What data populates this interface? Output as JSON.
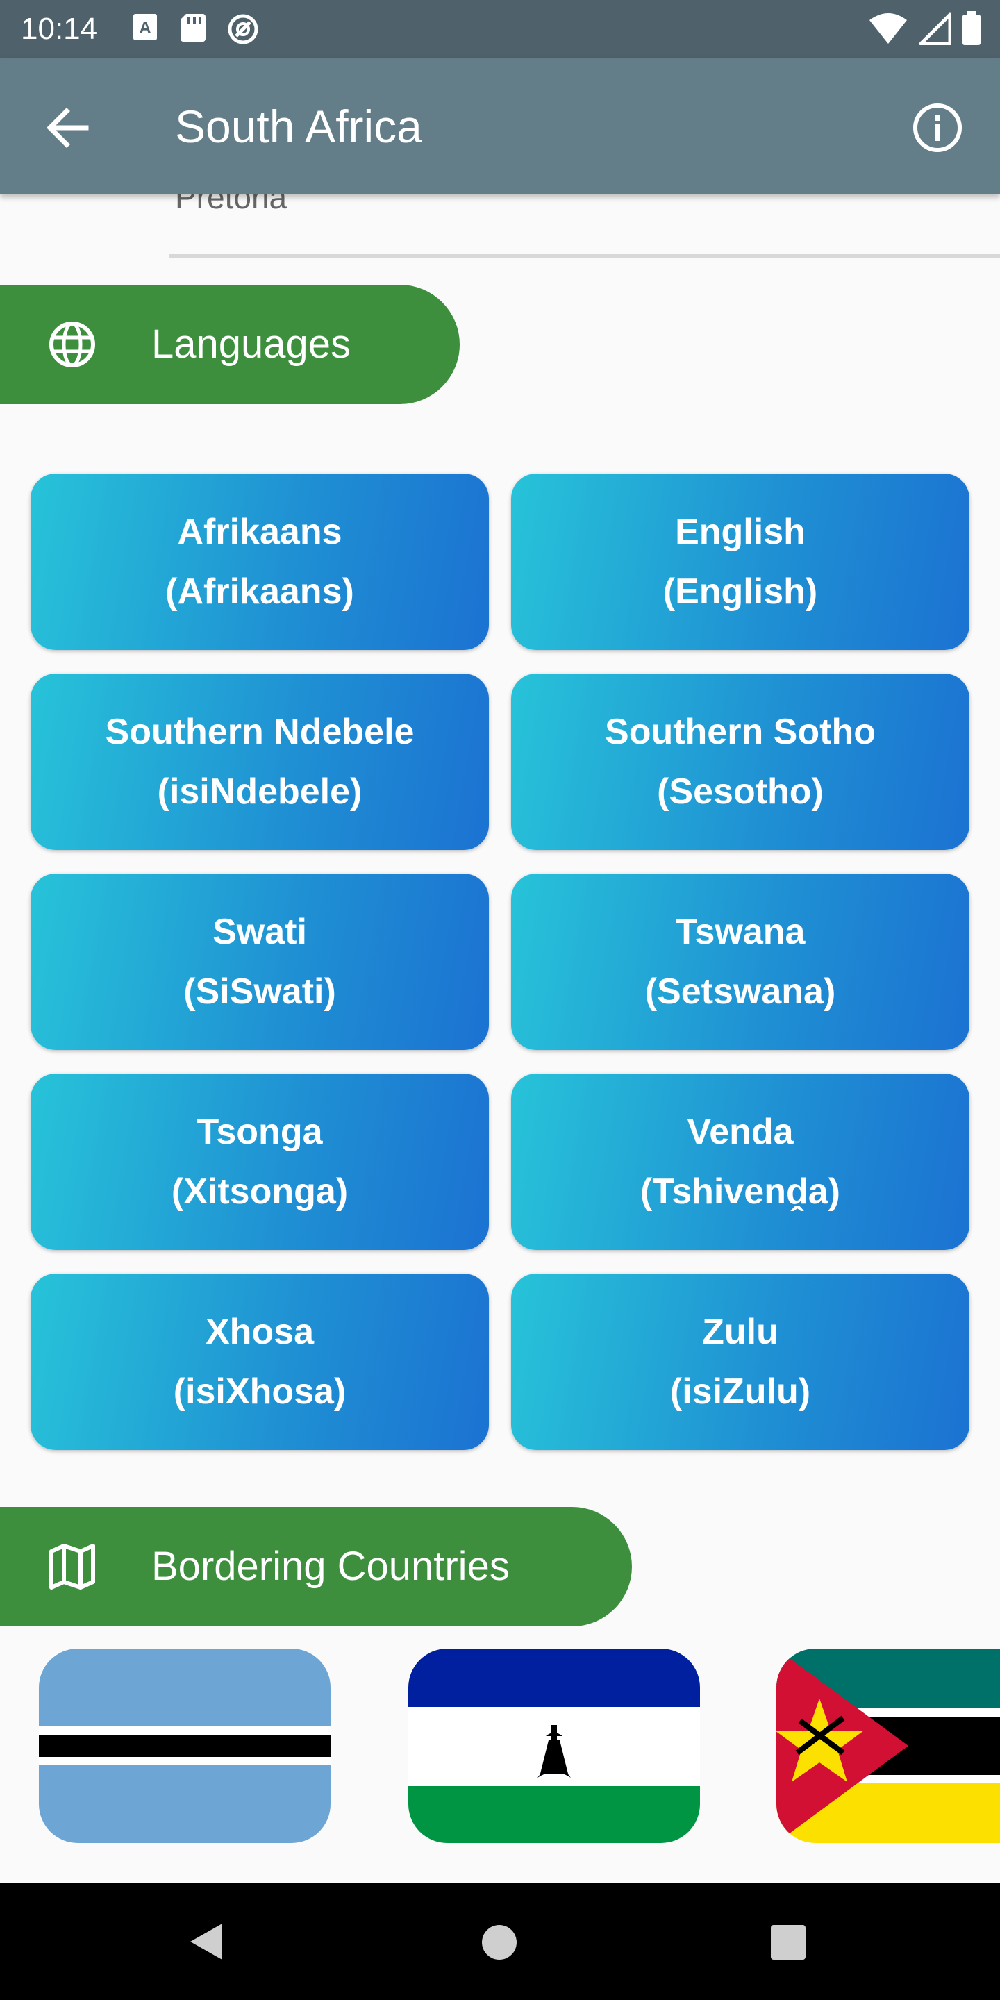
{
  "status_bar": {
    "time": "10:14",
    "icons_left": [
      "keyboard-a-icon",
      "sd-card-icon",
      "no-disturb-icon"
    ],
    "icons_right": [
      "wifi-icon",
      "signal-icon",
      "battery-icon"
    ]
  },
  "app_bar": {
    "title": "South Africa",
    "back_icon": "arrow-back-icon",
    "info_icon": "info-icon"
  },
  "capital": {
    "value": "Pretoria"
  },
  "languages_section": {
    "label": "Languages",
    "icon": "globe-icon",
    "items": [
      {
        "name": "Afrikaans",
        "native": "(Afrikaans)"
      },
      {
        "name": "English",
        "native": "(English)"
      },
      {
        "name": "Southern Ndebele",
        "native": "(isiNdebele)"
      },
      {
        "name": "Southern Sotho",
        "native": "(Sesotho)"
      },
      {
        "name": "Swati",
        "native": "(SiSwati)"
      },
      {
        "name": "Tswana",
        "native": "(Setswana)"
      },
      {
        "name": "Tsonga",
        "native": "(Xitsonga)"
      },
      {
        "name": "Venda",
        "native": "(Tshivenḓa)"
      },
      {
        "name": "Xhosa",
        "native": "(isiXhosa)"
      },
      {
        "name": "Zulu",
        "native": "(isiZulu)"
      }
    ]
  },
  "bordering_section": {
    "label": "Bordering Countries",
    "icon": "map-icon",
    "flags": [
      "botswana-flag",
      "lesotho-flag",
      "mozambique-flag"
    ]
  },
  "colors": {
    "status_bar": "#4f616b",
    "app_bar": "#647e89",
    "section_green": "#3d8f3d",
    "card_gradient_start": "#27c3d9",
    "card_gradient_end": "#1b72d2"
  },
  "nav_bar": {
    "icons": [
      "nav-back-icon",
      "nav-home-icon",
      "nav-recents-icon"
    ]
  }
}
